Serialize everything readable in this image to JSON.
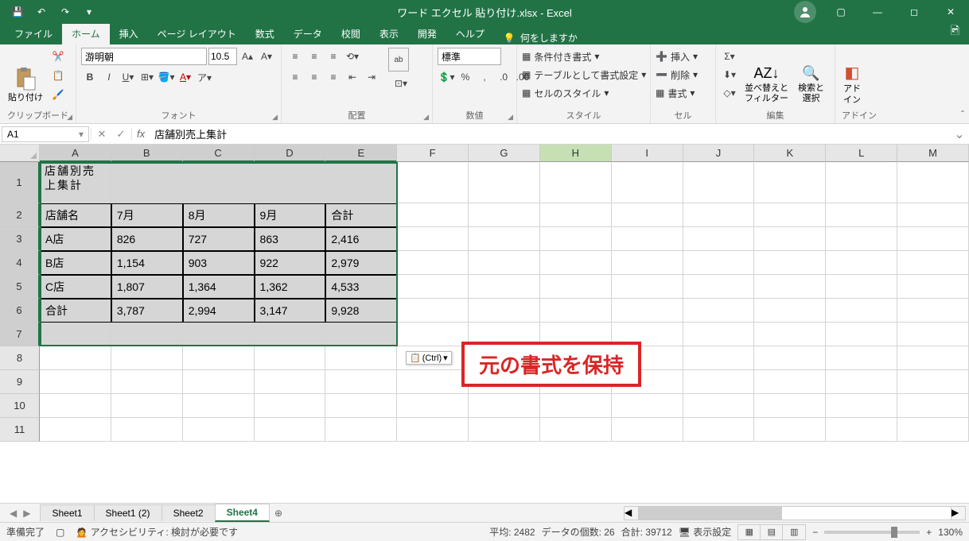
{
  "chart_data": {
    "type": "table",
    "title": "店舗別売上集計",
    "columns": [
      "店舗名",
      "7月",
      "8月",
      "9月",
      "合計"
    ],
    "rows": [
      [
        "A店",
        826,
        727,
        863,
        2416
      ],
      [
        "B店",
        1154,
        903,
        922,
        2979
      ],
      [
        "C店",
        1807,
        1364,
        1362,
        4533
      ],
      [
        "合計",
        3787,
        2994,
        3147,
        9928
      ]
    ]
  },
  "titlebar": {
    "document": "ワード エクセル 貼り付け.xlsx",
    "app": "Excel"
  },
  "tabs": {
    "file": "ファイル",
    "home": "ホーム",
    "insert": "挿入",
    "layout": "ページ レイアウト",
    "formulas": "数式",
    "data": "データ",
    "review": "校閲",
    "view": "表示",
    "developer": "開発",
    "help": "ヘルプ",
    "tellme": "何をしますか"
  },
  "ribbon": {
    "clipboard": {
      "paste": "貼り付け",
      "label": "クリップボード"
    },
    "font": {
      "name": "游明朝",
      "size": "10.5",
      "label": "フォント"
    },
    "alignment": {
      "wrap": "ab",
      "merge": "",
      "label": "配置"
    },
    "number": {
      "format": "標準",
      "label": "数値"
    },
    "styles": {
      "cond": "条件付き書式",
      "tablefmt": "テーブルとして書式設定",
      "cellstyle": "セルのスタイル",
      "label": "スタイル"
    },
    "cells": {
      "insert": "挿入",
      "delete": "削除",
      "format": "書式",
      "label": "セル"
    },
    "editing": {
      "sort": "並べ替えと\nフィルター",
      "find": "検索と\n選択",
      "label": "編集"
    },
    "addin": {
      "label_btn": "アド\nイン",
      "label": "アドイン"
    }
  },
  "formulabar": {
    "cellref": "A1",
    "content": "店舗別売上集計"
  },
  "columns": [
    "A",
    "B",
    "C",
    "D",
    "E",
    "F",
    "G",
    "H",
    "I",
    "J",
    "K",
    "L",
    "M"
  ],
  "rows": [
    "1",
    "2",
    "3",
    "4",
    "5",
    "6",
    "7",
    "8",
    "9",
    "10",
    "11"
  ],
  "cells": {
    "r1c0": "店舗別売上集計",
    "r2c0": "店舗名",
    "r2c1": "7月",
    "r2c2": "8月",
    "r2c3": "9月",
    "r2c4": "合計",
    "r3c0": "A店",
    "r3c1": "826",
    "r3c2": "727",
    "r3c3": "863",
    "r3c4": "2,416",
    "r4c0": "B店",
    "r4c1": "1,154",
    "r4c2": "903",
    "r4c3": "922",
    "r4c4": "2,979",
    "r5c0": "C店",
    "r5c1": "1,807",
    "r5c2": "1,364",
    "r5c3": "1,362",
    "r5c4": "4,533",
    "r6c0": "合計",
    "r6c1": "3,787",
    "r6c2": "2,994",
    "r6c3": "3,147",
    "r6c4": "9,928"
  },
  "paste_options": "(Ctrl)",
  "annotation": "元の書式を保持",
  "sheets": {
    "s1": "Sheet1",
    "s2": "Sheet1 (2)",
    "s3": "Sheet2",
    "s4": "Sheet4"
  },
  "statusbar": {
    "ready": "準備完了",
    "access": "アクセシビリティ: 検討が必要です",
    "avg": "平均: 2482",
    "count": "データの個数: 26",
    "sum": "合計: 39712",
    "display": "表示設定",
    "zoom": "130%"
  }
}
